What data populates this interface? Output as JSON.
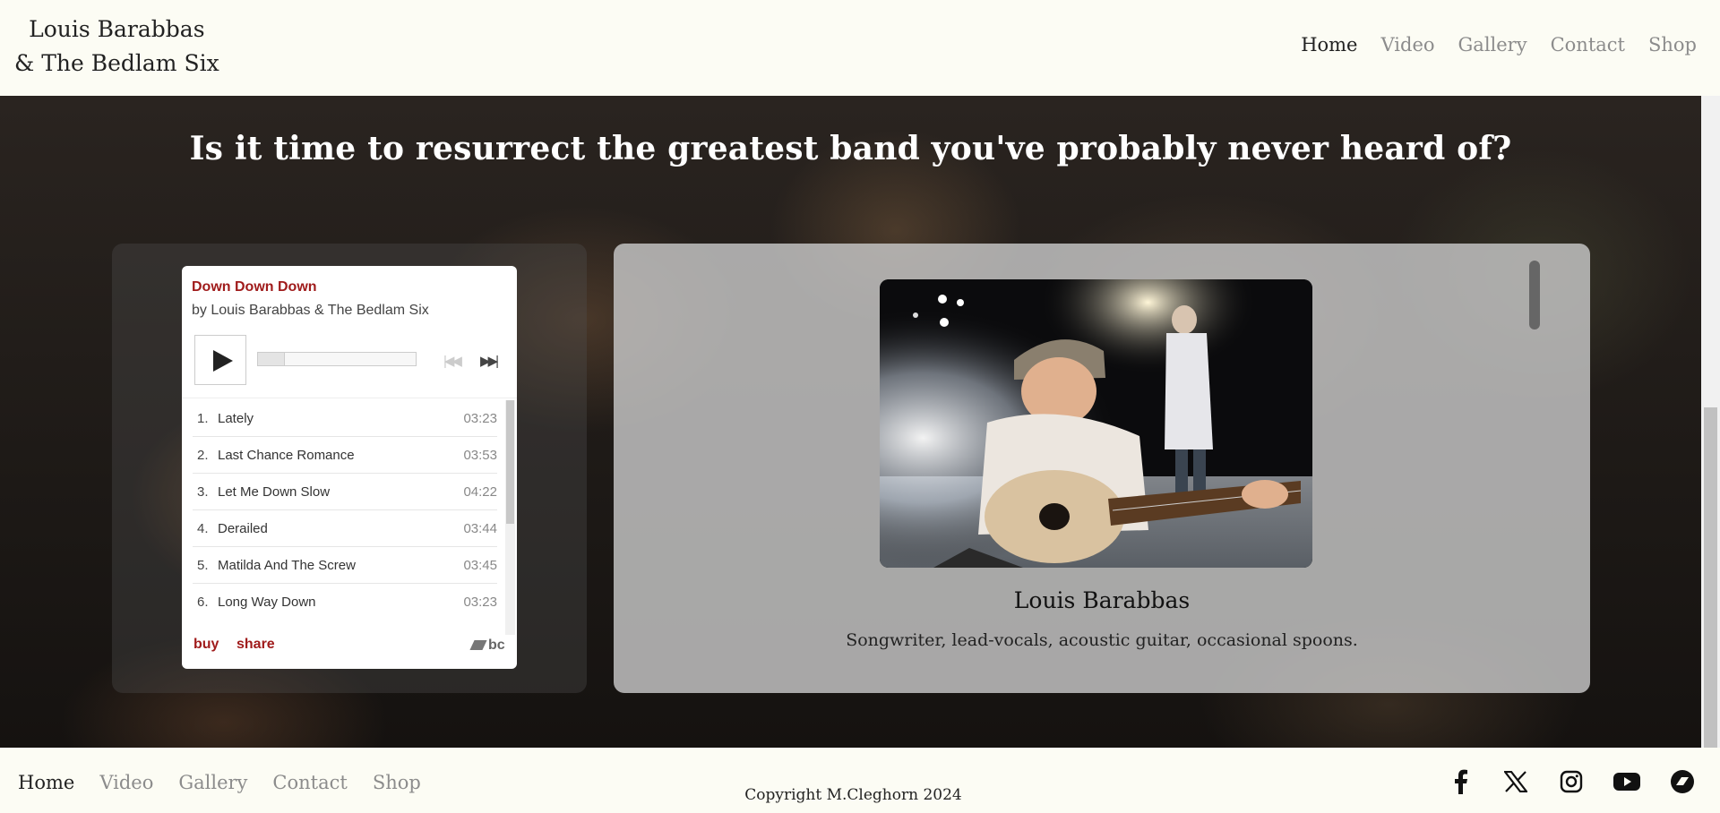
{
  "header": {
    "brand_line1": "Louis Barabbas",
    "brand_line2": "& The Bedlam Six",
    "nav": [
      "Home",
      "Video",
      "Gallery",
      "Contact",
      "Shop"
    ],
    "active_nav": "Home"
  },
  "hero": {
    "headline": "Is it time to resurrect the greatest band you've probably never heard of?"
  },
  "player": {
    "album_title": "Down Down Down",
    "album_artist": "by Louis Barabbas & The Bedlam Six",
    "tracks": [
      {
        "num": "1.",
        "name": "Lately",
        "duration": "03:23"
      },
      {
        "num": "2.",
        "name": "Last Chance Romance",
        "duration": "03:53"
      },
      {
        "num": "3.",
        "name": "Let Me Down Slow",
        "duration": "04:22"
      },
      {
        "num": "4.",
        "name": "Derailed",
        "duration": "03:44"
      },
      {
        "num": "5.",
        "name": "Matilda And The Screw",
        "duration": "03:45"
      },
      {
        "num": "6.",
        "name": "Long Way Down",
        "duration": "03:23"
      }
    ],
    "buy_label": "buy",
    "share_label": "share",
    "logo_text": "bc",
    "icons": {
      "play": "play-icon",
      "prev": "skip-previous-icon",
      "next": "skip-next-icon"
    }
  },
  "bio": {
    "name": "Louis Barabbas",
    "description": "Songwriter, lead-vocals, acoustic guitar, occasional spoons."
  },
  "footer": {
    "nav": [
      "Home",
      "Video",
      "Gallery",
      "Contact",
      "Shop"
    ],
    "active_nav": "Home",
    "copyright": "Copyright M.Cleghorn 2024",
    "social_icons": [
      "facebook-icon",
      "x-icon",
      "instagram-icon",
      "youtube-icon",
      "bandcamp-icon"
    ]
  }
}
